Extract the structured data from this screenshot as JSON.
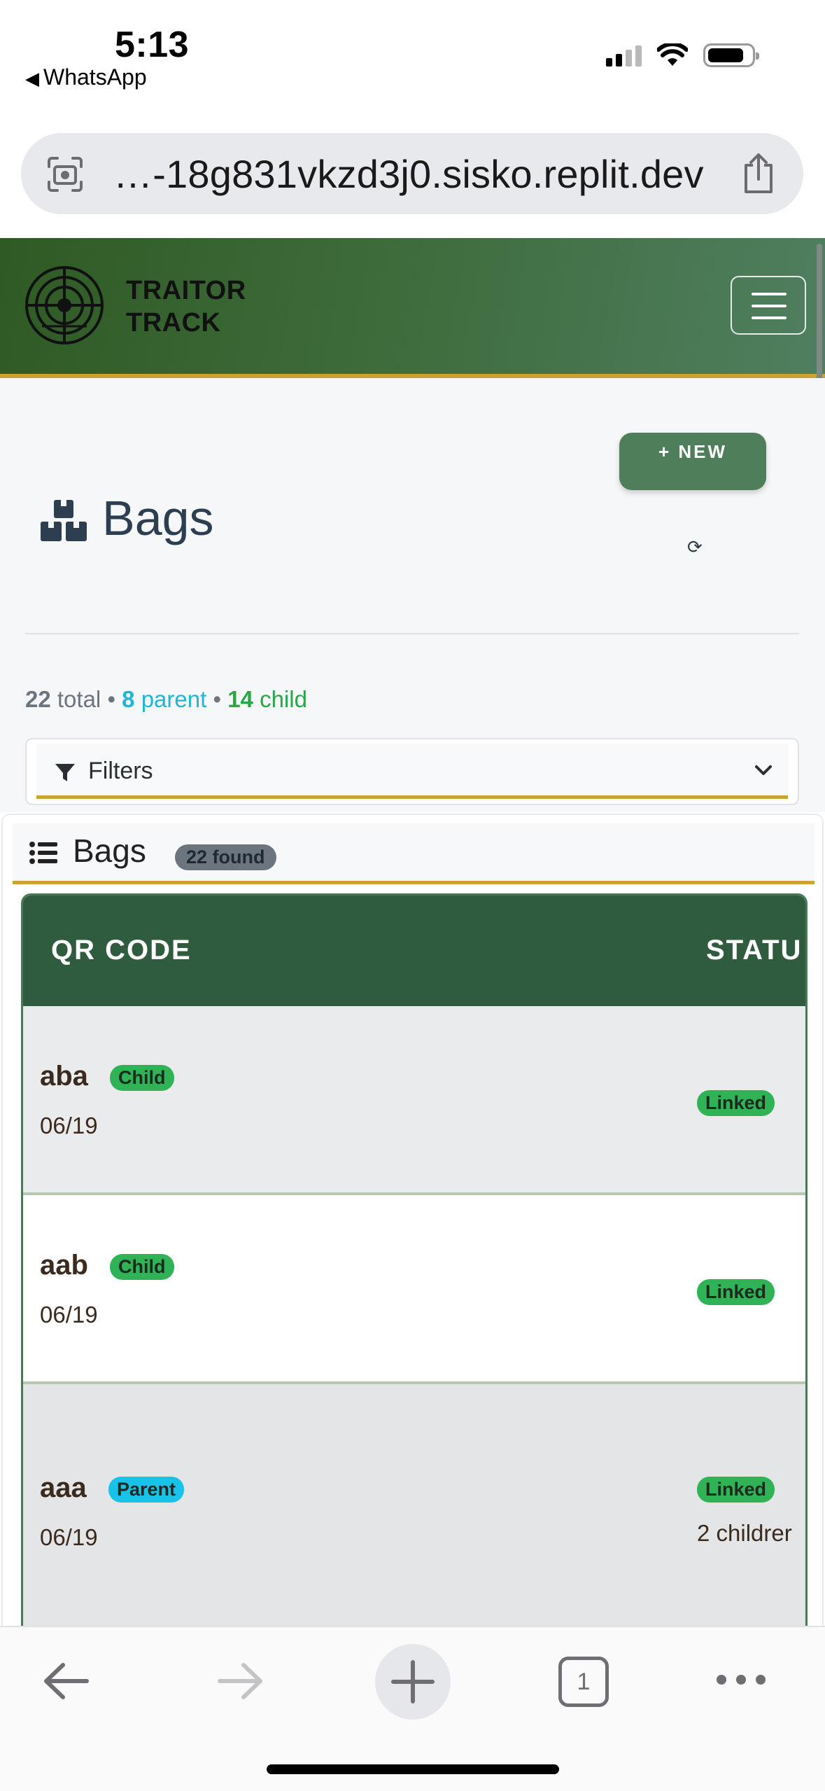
{
  "status_bar": {
    "time": "5:13",
    "back_app": "WhatsApp"
  },
  "browser": {
    "url": "…-18g831vkzd3j0.sisko.replit.dev"
  },
  "app": {
    "brand_line1": "TRAITOR",
    "brand_line2": "TRACK",
    "accent_color": "#c9a431",
    "header_color": "#2f5a24"
  },
  "page": {
    "title": "Bags",
    "new_button": "+ NEW",
    "stats": {
      "total": "22",
      "total_label": "total",
      "sep": "•",
      "parent": "8",
      "parent_label": "parent",
      "child": "14",
      "child_label": "child"
    },
    "filters_label": "Filters"
  },
  "card": {
    "title": "Bags",
    "found": "22 found"
  },
  "table": {
    "columns": [
      "QR CODE",
      "STATU"
    ],
    "rows": [
      {
        "code": "aba",
        "type": "Child",
        "date": "06/19",
        "status": "Linked",
        "children": ""
      },
      {
        "code": "aab",
        "type": "Child",
        "date": "06/19",
        "status": "Linked",
        "children": ""
      },
      {
        "code": "aaa",
        "type": "Parent",
        "date": "06/19",
        "status": "Linked",
        "children": "2 childrer"
      }
    ]
  },
  "toolbar": {
    "tab_count": "1"
  },
  "icons": [
    "camera-search-icon",
    "share-icon",
    "crosshair-logo-icon",
    "hamburger-icon",
    "refresh-icon",
    "boxes-icon",
    "filter-icon",
    "chevron-down-icon",
    "list-icon",
    "back-arrow-icon",
    "forward-arrow-icon",
    "plus-icon",
    "tabs-icon",
    "more-icon"
  ]
}
